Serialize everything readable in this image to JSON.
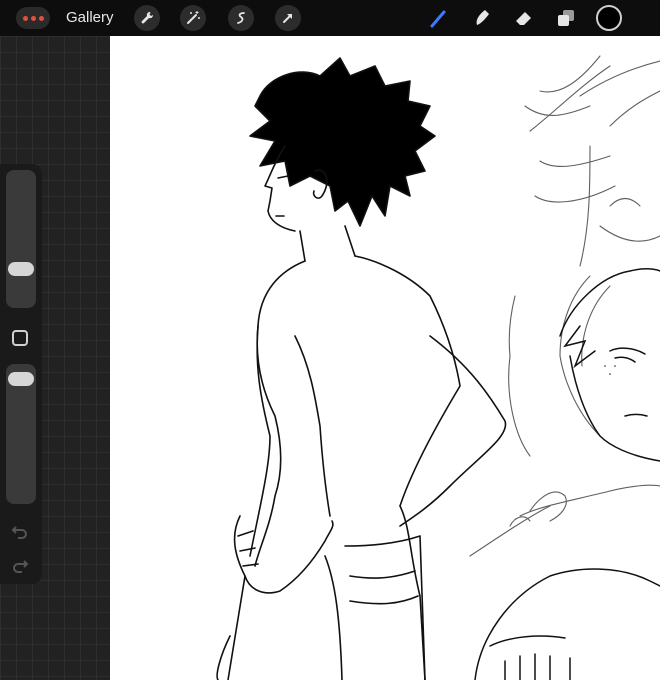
{
  "app": {
    "gallery_label": "Gallery"
  },
  "toolbar": {
    "left_tools": [
      "wrench-icon",
      "magic-wand-icon",
      "selection-icon",
      "transform-arrow-icon"
    ],
    "right_tools": [
      "brush-icon",
      "smudge-icon",
      "eraser-icon",
      "layers-icon"
    ],
    "active_tool": "brush-icon",
    "active_tool_color": "#3b7bff",
    "current_color": "#000000"
  },
  "sidebar": {
    "brush_size_level": 0.25,
    "opacity_level": 0.95
  }
}
